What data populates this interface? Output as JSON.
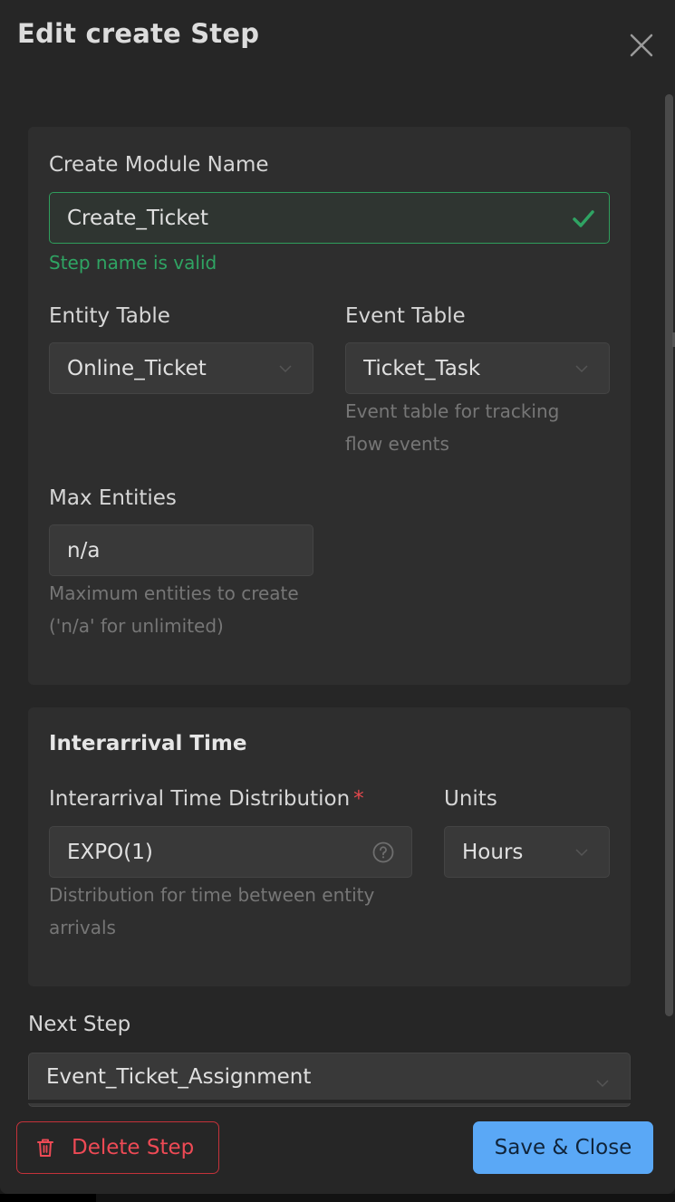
{
  "dialog": {
    "title": "Edit create Step"
  },
  "module_card": {
    "name_label": "Create Module Name",
    "name_value": "Create_Ticket",
    "name_valid_message": "Step name is valid",
    "entity_table_label": "Entity Table",
    "entity_table_value": "Online_Ticket",
    "event_table_label": "Event Table",
    "event_table_value": "Ticket_Task",
    "event_table_help_line1": "Event table for tracking",
    "event_table_help_line2": "flow events",
    "max_entities_label": "Max Entities",
    "max_entities_value": "n/a",
    "max_entities_help_line1": "Maximum entities to create",
    "max_entities_help_line2": "('n/a' for unlimited)"
  },
  "interarrival_card": {
    "title": "Interarrival Time",
    "distribution_label": "Interarrival Time Distribution",
    "required_marker": "*",
    "distribution_value": "EXPO(1)",
    "distribution_help_line1": "Distribution for time between entity",
    "distribution_help_line2": "arrivals",
    "units_label": "Units",
    "units_value": "Hours"
  },
  "next_step": {
    "label": "Next Step",
    "value": "Event_Ticket_Assignment"
  },
  "footer": {
    "delete_label": "Delete Step",
    "save_label": "Save & Close"
  },
  "colors": {
    "background": "#262626",
    "card": "#2e2e2e",
    "valid_green": "#2fa463",
    "danger_red": "#ee4a55",
    "primary_blue": "#5aa8f6"
  },
  "icons": [
    "close-icon",
    "check-icon",
    "chevron-down-icon",
    "help-circle-icon",
    "trash-icon"
  ]
}
